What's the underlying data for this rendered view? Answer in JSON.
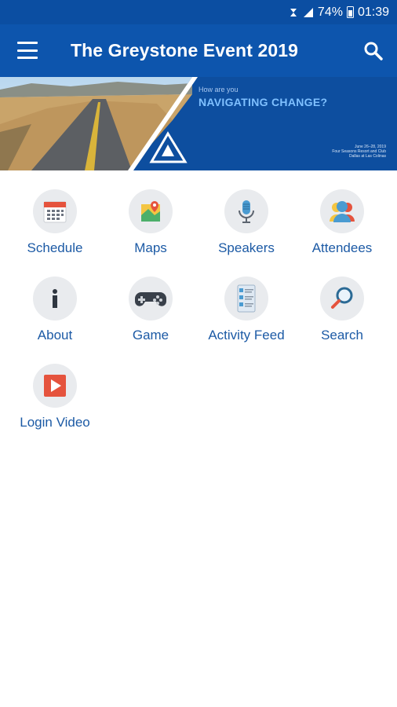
{
  "status_bar": {
    "battery": "74%",
    "time": "01:39"
  },
  "app_bar": {
    "title": "The Greystone Event 2019"
  },
  "banner": {
    "question": "How are you",
    "headline": "NAVIGATING CHANGE?",
    "details_line1": "June 26–28, 2019",
    "details_line2": "Four Seasons Resort and Club",
    "details_line3": "Dallas at Las Colinas"
  },
  "menu": {
    "items": [
      {
        "label": "Schedule",
        "icon": "calendar-icon"
      },
      {
        "label": "Maps",
        "icon": "map-icon"
      },
      {
        "label": "Speakers",
        "icon": "microphone-icon"
      },
      {
        "label": "Attendees",
        "icon": "people-icon"
      },
      {
        "label": "About",
        "icon": "info-icon"
      },
      {
        "label": "Game",
        "icon": "gamepad-icon"
      },
      {
        "label": "Activity Feed",
        "icon": "activity-feed-icon"
      },
      {
        "label": "Search",
        "icon": "magnifier-icon"
      },
      {
        "label": "Login Video",
        "icon": "play-video-icon"
      }
    ]
  },
  "colors": {
    "status_bar": "#0b4ea2",
    "app_bar": "#0d55ad",
    "label_text": "#1c5aa5",
    "icon_circle": "#e9ebee"
  }
}
